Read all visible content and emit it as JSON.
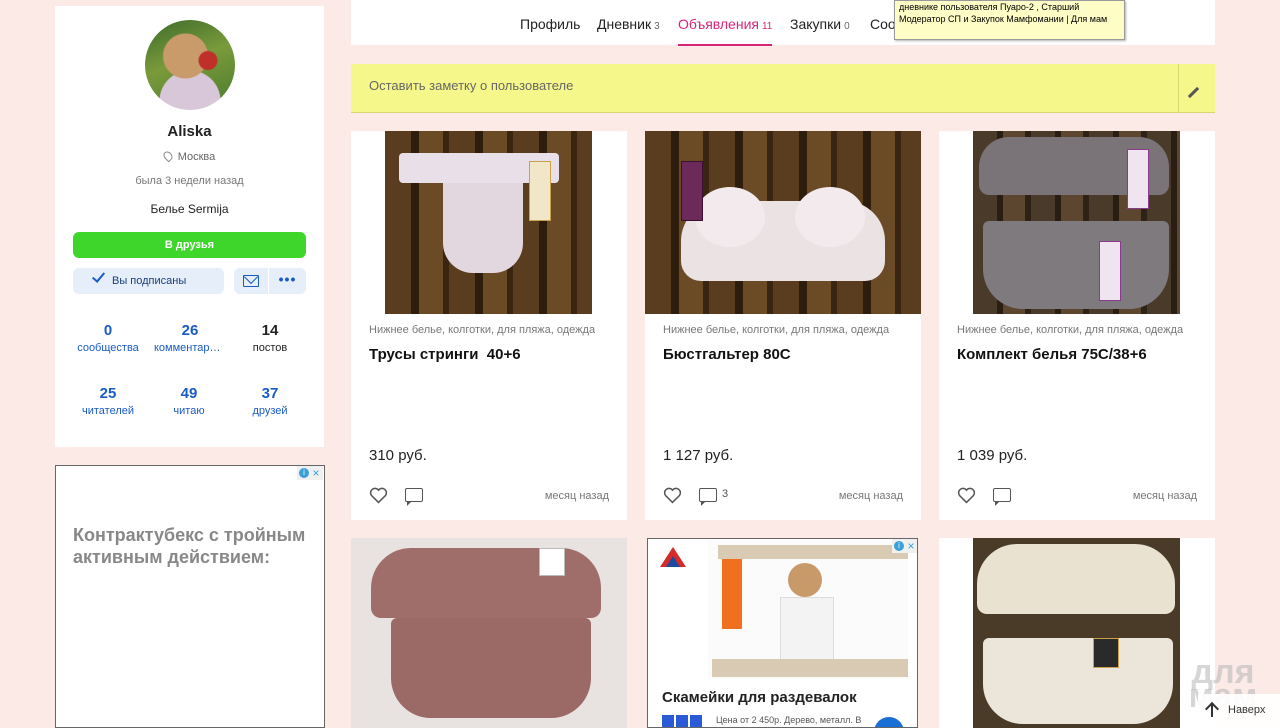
{
  "profile": {
    "username": "Aliska",
    "location": "Москва",
    "last_seen": "была 3 недели назад",
    "status": "Белье Sermija",
    "add_friend_label": "В друзья",
    "subscribed_label": "Вы подписаны",
    "more_label": "•••",
    "stats": [
      {
        "num": "0",
        "label": "сообщества"
      },
      {
        "num": "26",
        "label": "комментариев"
      },
      {
        "num": "14",
        "label": "постов"
      },
      {
        "num": "25",
        "label": "читателей"
      },
      {
        "num": "49",
        "label": "читаю"
      },
      {
        "num": "37",
        "label": "друзей"
      }
    ]
  },
  "left_ad": {
    "text": "Контрактубекс с тройным активным действием:"
  },
  "tabs": [
    {
      "label": "Профиль",
      "count": ""
    },
    {
      "label": "Дневник",
      "count": "3"
    },
    {
      "label": "Объявления",
      "count": "11"
    },
    {
      "label": "Закупки",
      "count": "0"
    },
    {
      "label": "Соо",
      "count": ""
    }
  ],
  "tooltip": {
    "text": "дневнике пользователя Пуаро-2 , Старший Модератор СП и Закупок Мамфомании | Для мам"
  },
  "note": {
    "placeholder": "Оставить заметку о пользователе"
  },
  "cards": [
    {
      "category": "Нижнее белье, колготки, для пляжа, одежда",
      "title": "Трусы стринги  40+6",
      "price": "310 руб.",
      "comments": "",
      "time": "месяц назад"
    },
    {
      "category": "Нижнее белье, колготки, для пляжа, одежда",
      "title": "Бюстгальтер 80С",
      "price": "1 127 руб.",
      "comments": "3",
      "time": "месяц назад"
    },
    {
      "category": "Нижнее белье, колготки, для пляжа, одежда",
      "title": "Комплект белья 75C/38+6",
      "price": "1 039 руб.",
      "comments": "",
      "time": "месяц назад"
    }
  ],
  "ad_card": {
    "title": "Скамейки для раздевалок",
    "subtitle": "Цена от 2 450р. Дерево, металл. В"
  },
  "watermark": "для мам",
  "scroll_top_label": "Наверх",
  "colors": {
    "accent": "#d6267a",
    "link": "#1a5bc4",
    "add_friend": "#3fd62c",
    "note_bg": "#f6f78a",
    "page_bg": "#fbeae6"
  }
}
